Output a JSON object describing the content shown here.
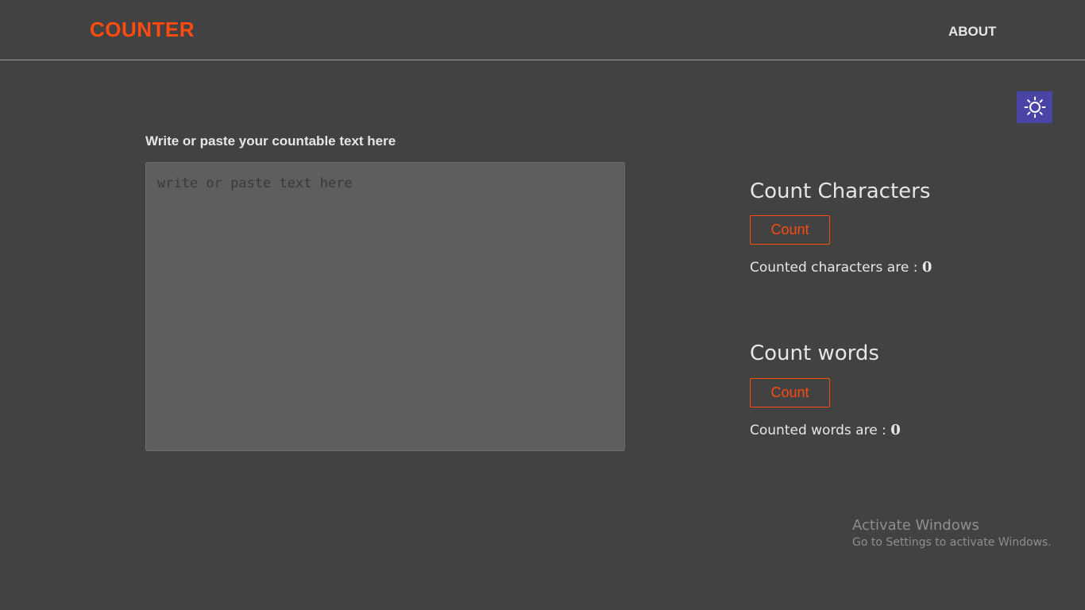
{
  "navbar": {
    "logo": "COUNTER",
    "about_label": "ABOUT"
  },
  "theme_toggle": {
    "icon": "sun-icon",
    "color": "#4a44a6"
  },
  "editor": {
    "label": "Write or paste your countable text here",
    "placeholder": "write or paste text here",
    "value": ""
  },
  "characters": {
    "heading": "Count Characters",
    "button_label": "Count",
    "result_label": "Counted characters are :",
    "result_value": "0"
  },
  "words": {
    "heading": "Count words",
    "button_label": "Count",
    "result_label": "Counted words are :",
    "result_value": "0"
  },
  "watermark": {
    "title": "Activate Windows",
    "subtitle": "Go to Settings to activate Windows."
  },
  "colors": {
    "background": "#424242",
    "accent": "#ff4a10",
    "text": "#e6e6e6",
    "editor_bg": "#5e5e5e"
  }
}
